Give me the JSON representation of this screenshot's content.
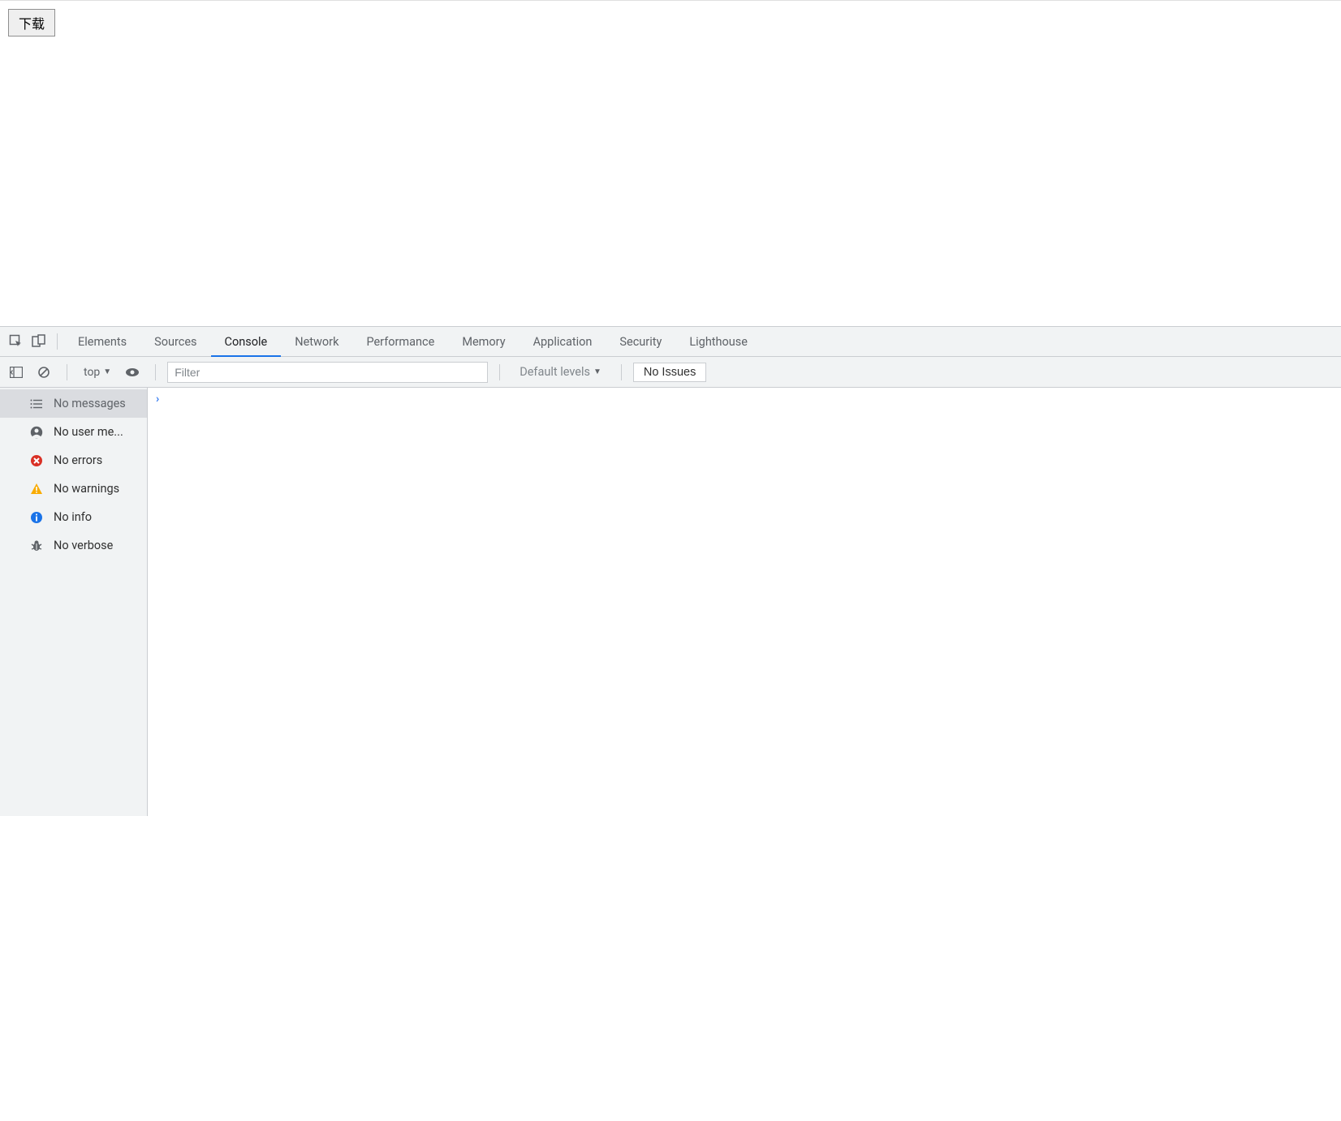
{
  "page": {
    "download_label": "下载"
  },
  "devtools": {
    "tabs": [
      "Elements",
      "Sources",
      "Console",
      "Network",
      "Performance",
      "Memory",
      "Application",
      "Security",
      "Lighthouse"
    ],
    "active_tab": "Console"
  },
  "toolbar": {
    "context": "top",
    "filter_placeholder": "Filter",
    "levels_label": "Default levels",
    "issues_label": "No Issues"
  },
  "sidebar": {
    "items": [
      {
        "key": "messages",
        "label": "No messages"
      },
      {
        "key": "user",
        "label": "No user me..."
      },
      {
        "key": "errors",
        "label": "No errors"
      },
      {
        "key": "warnings",
        "label": "No warnings"
      },
      {
        "key": "info",
        "label": "No info"
      },
      {
        "key": "verbose",
        "label": "No verbose"
      }
    ],
    "selected": "messages"
  },
  "console": {
    "prompt": "›"
  }
}
